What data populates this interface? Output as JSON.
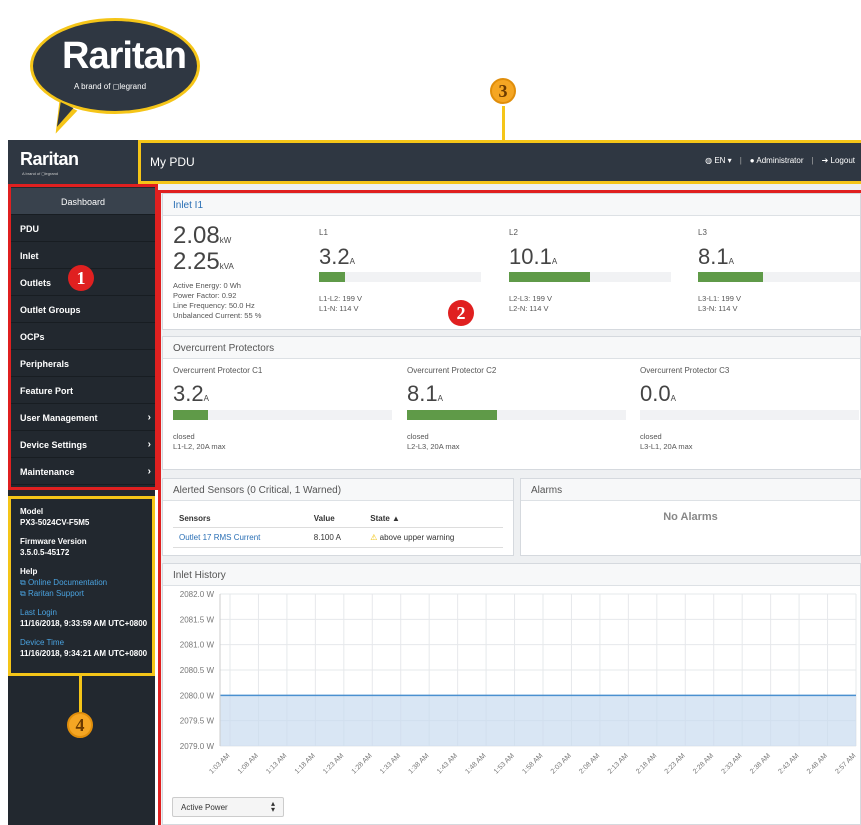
{
  "callout": {
    "logo": "Raritan",
    "tagline": "A brand of ◻legrand",
    "numbers": [
      "1",
      "2",
      "3",
      "4"
    ]
  },
  "topbar": {
    "logo": "Raritan",
    "logo_sub": "A brand of ◻legrand",
    "title": "My PDU",
    "language": "EN ▾",
    "user": "Administrator",
    "logout": "Logout",
    "separator": "|"
  },
  "sidebar": {
    "items": [
      {
        "label": "Dashboard",
        "chevron": false
      },
      {
        "label": "PDU",
        "chevron": false
      },
      {
        "label": "Inlet",
        "chevron": false
      },
      {
        "label": "Outlets",
        "chevron": false
      },
      {
        "label": "Outlet Groups",
        "chevron": false
      },
      {
        "label": "OCPs",
        "chevron": false
      },
      {
        "label": "Peripherals",
        "chevron": false
      },
      {
        "label": "Feature Port",
        "chevron": false
      },
      {
        "label": "User Management",
        "chevron": true
      },
      {
        "label": "Device Settings",
        "chevron": true
      },
      {
        "label": "Maintenance",
        "chevron": true
      }
    ],
    "chevron": "›",
    "info": {
      "model_label": "Model",
      "model": "PX3-5024CV-F5M5",
      "firmware_label": "Firmware Version",
      "firmware": "3.5.0.5-45172",
      "help_label": "Help",
      "help_link1": "Online Documentation",
      "help_link2": "Raritan Support",
      "last_login_label": "Last Login",
      "last_login": "11/16/2018, 9:33:59 AM UTC+0800",
      "device_time_label": "Device Time",
      "device_time": "11/16/2018, 9:34:21 AM UTC+0800"
    }
  },
  "inlet": {
    "title": "Inlet I1",
    "power_value": "2.08",
    "power_unit": "kW",
    "apparent_value": "2.25",
    "apparent_unit": "kVA",
    "active_energy": "Active Energy: 0 Wh",
    "power_factor": "Power Factor: 0.92",
    "line_frequency": "Line Frequency: 50.0 Hz",
    "unbalanced": "Unbalanced Current: 55 %",
    "lines": [
      {
        "name": "L1",
        "value": "3.2",
        "unit": "A",
        "fill": 0.16,
        "v1": "L1-L2: 199 V",
        "v2": "L1-N: 114 V"
      },
      {
        "name": "L2",
        "value": "10.1",
        "unit": "A",
        "fill": 0.5,
        "v1": "L2-L3: 199 V",
        "v2": "L2-N: 114 V"
      },
      {
        "name": "L3",
        "value": "8.1",
        "unit": "A",
        "fill": 0.4,
        "v1": "L3-L1: 199 V",
        "v2": "L3-N: 114 V"
      }
    ]
  },
  "ocp": {
    "title": "Overcurrent Protectors",
    "items": [
      {
        "name": "Overcurrent Protector C1",
        "value": "3.2",
        "unit": "A",
        "fill": 0.16,
        "state": "closed",
        "desc": "L1-L2, 20A max"
      },
      {
        "name": "Overcurrent Protector C2",
        "value": "8.1",
        "unit": "A",
        "fill": 0.41,
        "state": "closed",
        "desc": "L2-L3, 20A max"
      },
      {
        "name": "Overcurrent Protector C3",
        "value": "0.0",
        "unit": "A",
        "fill": 0.0,
        "state": "closed",
        "desc": "L3-L1, 20A max"
      }
    ]
  },
  "sensors": {
    "title": "Alerted Sensors (0 Critical, 1 Warned)",
    "headers": [
      "Sensors",
      "Value",
      "State ▲"
    ],
    "rows": [
      {
        "sensor": "Outlet 17 RMS Current",
        "value": "8.100 A",
        "state": "above upper warning"
      }
    ]
  },
  "alarms": {
    "title": "Alarms",
    "empty": "No Alarms"
  },
  "history": {
    "title": "Inlet History",
    "select": "Active Power",
    "y_ticks": [
      "2082.0 W",
      "2081.5 W",
      "2081.0 W",
      "2080.5 W",
      "2080.0 W",
      "2079.5 W",
      "2079.0 W"
    ],
    "x_ticks": [
      "1:03 AM",
      "1:08 AM",
      "1:13 AM",
      "1:18 AM",
      "1:23 AM",
      "1:28 AM",
      "1:33 AM",
      "1:38 AM",
      "1:43 AM",
      "1:48 AM",
      "1:53 AM",
      "1:58 AM",
      "2:03 AM",
      "2:08 AM",
      "2:13 AM",
      "2:18 AM",
      "2:23 AM",
      "2:28 AM",
      "2:33 AM",
      "2:38 AM",
      "2:43 AM",
      "2:48 AM",
      "2:57 AM"
    ]
  },
  "chart_data": {
    "type": "area",
    "title": "Inlet History",
    "xlabel": "",
    "ylabel": "",
    "ylim": [
      2079.0,
      2082.0
    ],
    "x": [
      "1:03 AM",
      "1:08 AM",
      "1:13 AM",
      "1:18 AM",
      "1:23 AM",
      "1:28 AM",
      "1:33 AM",
      "1:38 AM",
      "1:43 AM",
      "1:48 AM",
      "1:53 AM",
      "1:58 AM",
      "2:03 AM",
      "2:08 AM",
      "2:13 AM",
      "2:18 AM",
      "2:23 AM",
      "2:28 AM",
      "2:33 AM",
      "2:38 AM",
      "2:43 AM",
      "2:48 AM",
      "2:57 AM"
    ],
    "values": [
      2080.0,
      2080.0,
      2080.0,
      2080.0,
      2080.0,
      2080.0,
      2080.0,
      2080.0,
      2080.0,
      2080.0,
      2080.0,
      2080.0,
      2080.0,
      2080.0,
      2080.0,
      2080.0,
      2080.0,
      2080.0,
      2080.0,
      2080.0,
      2080.0,
      2080.0,
      2080.0
    ],
    "grid": true,
    "colors": {
      "line": "#4a90d0",
      "fill": "#c9dcef"
    }
  }
}
